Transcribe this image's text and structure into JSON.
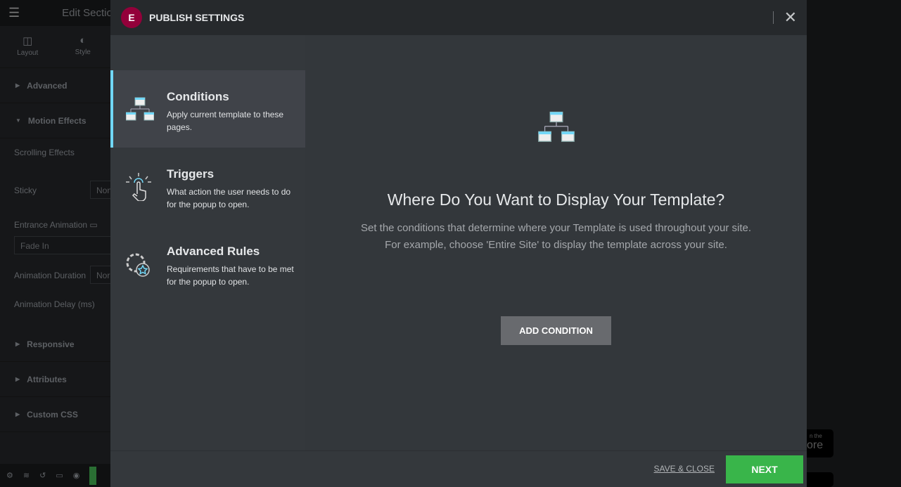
{
  "editor": {
    "title": "Edit Section",
    "tabs": [
      "Layout",
      "Style"
    ],
    "sections": {
      "advanced": "Advanced",
      "motion": "Motion Effects",
      "responsive": "Responsive",
      "attributes": "Attributes",
      "custom_css": "Custom CSS"
    },
    "fields": {
      "scrolling": "Scrolling Effects",
      "sticky": "Sticky",
      "sticky_value": "None",
      "entrance": "Entrance Animation",
      "entrance_value": "Fade In",
      "duration": "Animation Duration",
      "duration_value": "Normal",
      "delay": "Animation Delay (ms)"
    }
  },
  "modal": {
    "title": "PUBLISH SETTINGS",
    "logo": "E",
    "nav": [
      {
        "title": "Conditions",
        "desc": "Apply current template to these pages."
      },
      {
        "title": "Triggers",
        "desc": "What action the user needs to do for the popup to open."
      },
      {
        "title": "Advanced Rules",
        "desc": "Requirements that have to be met for the popup to open."
      }
    ],
    "main": {
      "heading": "Where Do You Want to Display Your Template?",
      "line1": "Set the conditions that determine where your Template is used throughout your site.",
      "line2": "For example, choose 'Entire Site' to display the template across your site.",
      "add_button": "ADD CONDITION"
    },
    "footer": {
      "save_close": "SAVE & CLOSE",
      "next": "NEXT"
    }
  },
  "colors": {
    "accent": "#71d7f7",
    "next": "#39b54a",
    "logo": "#93003a"
  },
  "background": {
    "store_text": "ore",
    "store_small": "n the"
  }
}
